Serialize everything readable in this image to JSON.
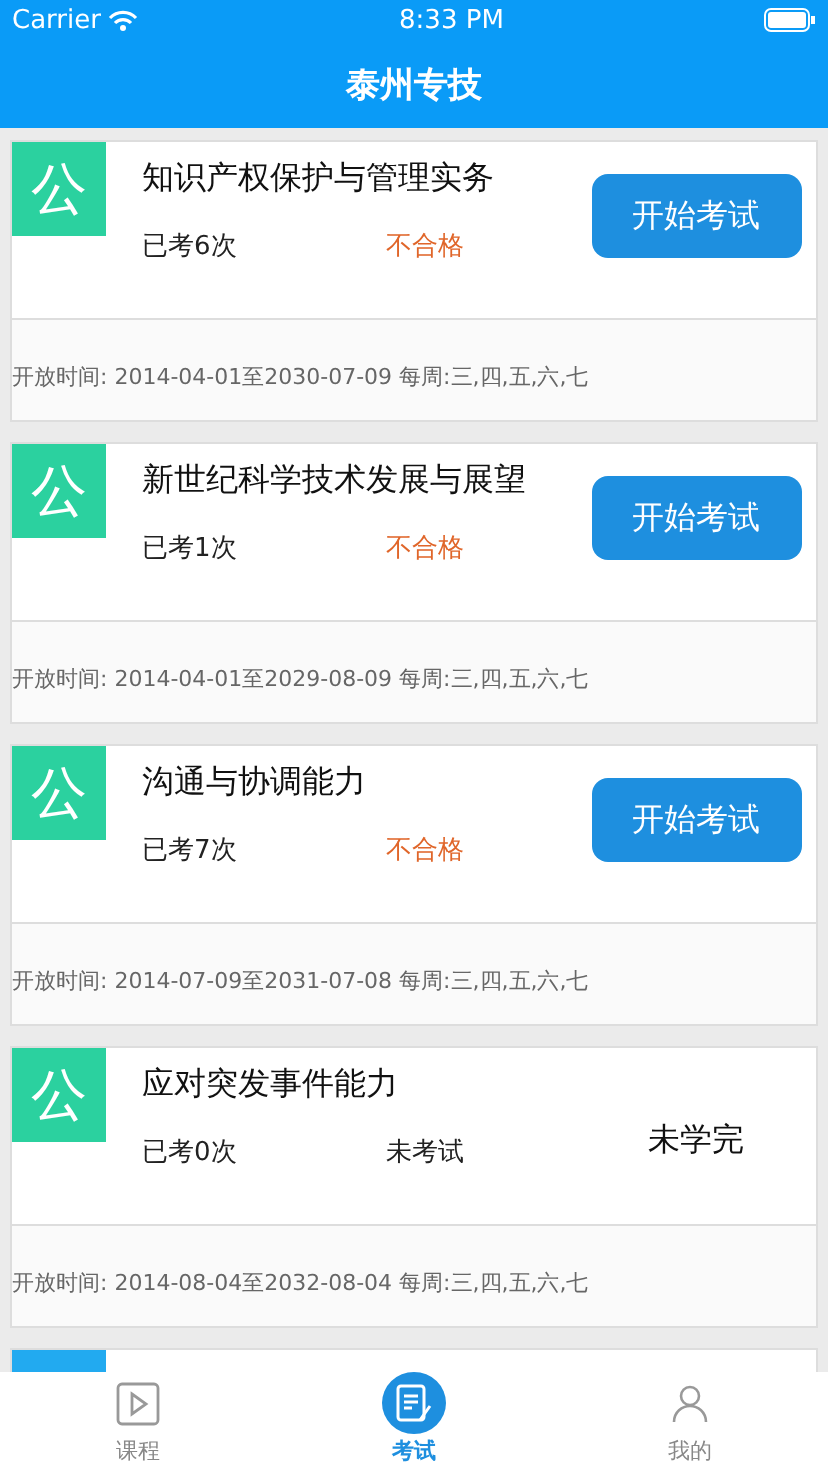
{
  "status_bar": {
    "carrier": "Carrier",
    "time": "8:33 PM"
  },
  "header": {
    "title": "泰州专技"
  },
  "courses": [
    {
      "badge": "公",
      "color": "#2bd19f",
      "title": "知识产权保护与管理实务",
      "attempts": "已考6次",
      "result": {
        "text": "不合格",
        "failed": true
      },
      "action": {
        "kind": "button",
        "label": "开始考试"
      },
      "schedule": "开放时间: 2014-04-01至2030-07-09 每周:三,四,五,六,七"
    },
    {
      "badge": "公",
      "color": "#2bd19f",
      "title": "新世纪科学技术发展与展望",
      "attempts": "已考1次",
      "result": {
        "text": "不合格",
        "failed": true
      },
      "action": {
        "kind": "button",
        "label": "开始考试"
      },
      "schedule": "开放时间: 2014-04-01至2029-08-09 每周:三,四,五,六,七"
    },
    {
      "badge": "公",
      "color": "#2bd19f",
      "title": "沟通与协调能力",
      "attempts": "已考7次",
      "result": {
        "text": "不合格",
        "failed": true
      },
      "action": {
        "kind": "button",
        "label": "开始考试"
      },
      "schedule": "开放时间: 2014-07-09至2031-07-08 每周:三,四,五,六,七"
    },
    {
      "badge": "公",
      "color": "#2bd19f",
      "title": "应对突发事件能力",
      "attempts": "已考0次",
      "result": {
        "text": "未考试",
        "failed": false
      },
      "action": {
        "kind": "text",
        "label": "未学完"
      },
      "schedule": "开放时间: 2014-08-04至2032-08-04 每周:三,四,五,六,七"
    },
    {
      "color": "#22aaf0"
    }
  ],
  "tabs": [
    {
      "label": "课程",
      "kind": "play",
      "selected": false
    },
    {
      "label": "考试",
      "kind": "exam",
      "selected": true
    },
    {
      "label": "我的",
      "kind": "person",
      "selected": false
    }
  ]
}
